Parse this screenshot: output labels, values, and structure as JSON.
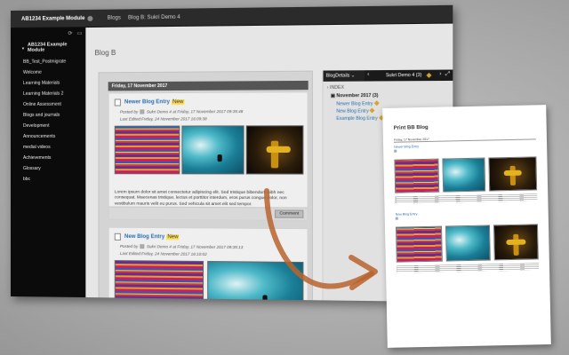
{
  "app": {
    "course": "AB1234 Example Module"
  },
  "header": {
    "crumbs": [
      "Blogs",
      "Blog B: Sukri Demo 4"
    ]
  },
  "sidebar": {
    "title": "AB1234 Example Module",
    "items": [
      "BB_Test_Postmigrate",
      "Welcome",
      "Learning Materials",
      "Learning Materials 2",
      "Online Assessment",
      "Blogs and journals",
      "Development",
      "Announcements",
      "medial videos",
      "Achievements",
      "Glossary",
      "bbc"
    ]
  },
  "page": {
    "title": "Blog B"
  },
  "blog": {
    "day": "Friday, 17 November 2017",
    "entries": [
      {
        "title": "Newer Blog Entry",
        "badge": "New",
        "posted": "Posted by",
        "author": "Sukri Demo 4",
        "date": "at Friday, 17 November 2017 09:35:48",
        "edited": "Last Edited:Friday, 24 November 2017 16:09:38",
        "body": "Lorem ipsum dolor sit amet consectetur adipiscing elit. Sed tristique bibendum nibh nec consequat. Maecenas tristique, lectus et porttitor interdum, eros purus congue dolor, non vestibulum mauris velit eu purus. Sed vehicula sit amet elit sed tempor.",
        "comment": "Comment"
      },
      {
        "title": "New Blog Entry",
        "badge": "New",
        "posted": "Posted by",
        "author": "Sukri Demo 4",
        "date": "at Friday, 17 November 2017 09:35:13",
        "edited": "Last Edited:Friday, 24 November 2017 16:10:02"
      }
    ]
  },
  "panel": {
    "header": "BlogDetails",
    "user": "Sukri Demo 4 (3)",
    "index": "INDEX",
    "month": "November 2017",
    "month_count": "(3)",
    "entries": [
      "Newer Blog Entry",
      "New Blog Entry",
      "Example Blog Entry"
    ]
  },
  "print": {
    "title": "Print BB Blog",
    "day": "Friday, 17 November 2017",
    "entry1": "Newer Blog Entry",
    "entry2": "New Blog Entry"
  },
  "colors": {
    "accent": "#2a6fb0",
    "arrow": "#b9642e",
    "badge": "#ffe15a"
  }
}
